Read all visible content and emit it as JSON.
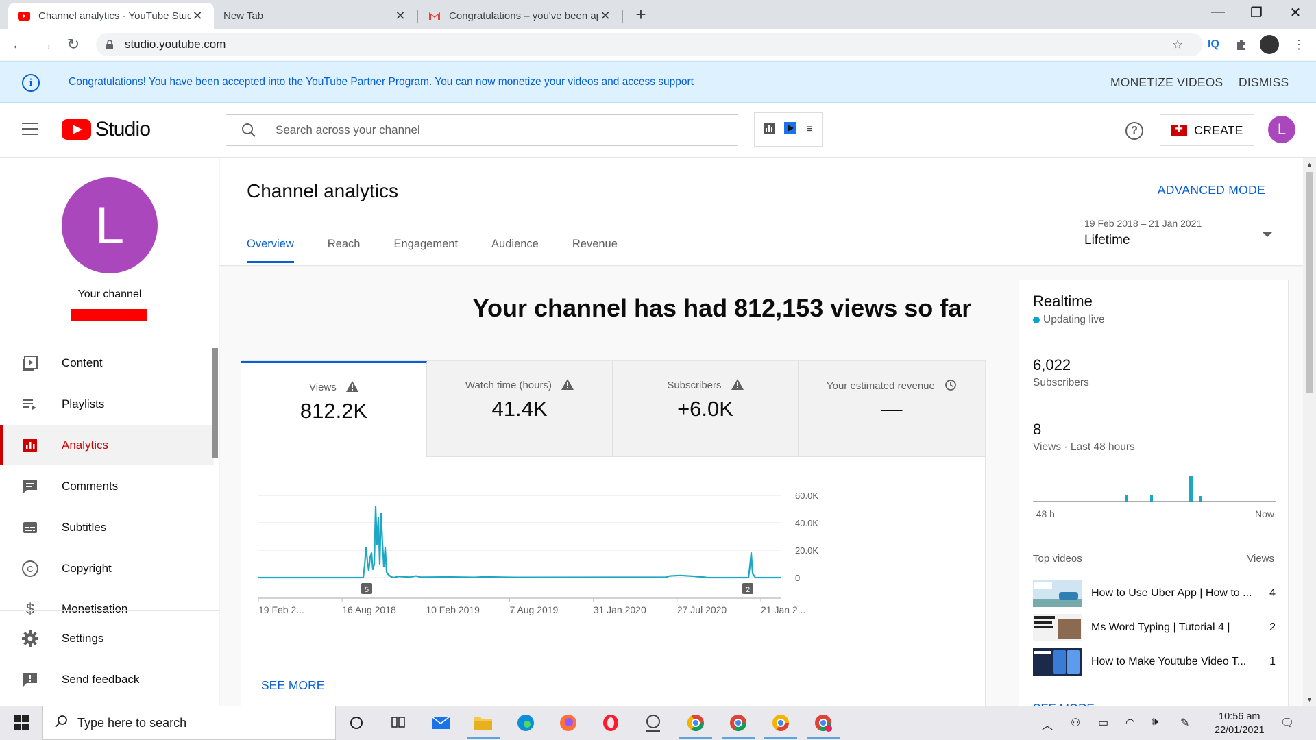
{
  "browser": {
    "tabs": [
      {
        "title": "Channel analytics - YouTube Studio"
      },
      {
        "title": "New Tab"
      },
      {
        "title": "Congratulations – you've been approved"
      }
    ],
    "url": "studio.youtube.com"
  },
  "banner": {
    "message": "Congratulations! You have been accepted into the YouTube Partner Program. You can now monetize your videos and access support",
    "monetize_label": "MONETIZE VIDEOS",
    "dismiss_label": "DISMISS"
  },
  "header": {
    "logo_text": "Studio",
    "search_placeholder": "Search across your channel",
    "create_label": "CREATE",
    "avatar_letter": "L"
  },
  "sidebar": {
    "avatar_letter": "L",
    "channel_label": "Your channel",
    "items": [
      {
        "label": "Content",
        "icon": "content-icon"
      },
      {
        "label": "Playlists",
        "icon": "playlists-icon"
      },
      {
        "label": "Analytics",
        "icon": "analytics-icon"
      },
      {
        "label": "Comments",
        "icon": "comments-icon"
      },
      {
        "label": "Subtitles",
        "icon": "subtitles-icon"
      },
      {
        "label": "Copyright",
        "icon": "copyright-icon"
      },
      {
        "label": "Monetisation",
        "icon": "monetisation-icon"
      },
      {
        "label": "Settings",
        "icon": "settings-icon"
      },
      {
        "label": "Send feedback",
        "icon": "feedback-icon"
      }
    ]
  },
  "page": {
    "title": "Channel analytics",
    "advanced_mode": "ADVANCED MODE",
    "tabs": [
      "Overview",
      "Reach",
      "Engagement",
      "Audience",
      "Revenue"
    ],
    "date_range": "19 Feb 2018 – 21 Jan 2021",
    "period": "Lifetime",
    "headline": "Your channel has had 812,153 views so far"
  },
  "metrics": [
    {
      "label": "Views",
      "value": "812.2K"
    },
    {
      "label": "Watch time (hours)",
      "value": "41.4K"
    },
    {
      "label": "Subscribers",
      "value": "+6.0K"
    },
    {
      "label": "Your estimated revenue",
      "value": "—"
    }
  ],
  "chart_data": {
    "type": "line",
    "series": [
      {
        "values": []
      }
    ],
    "x_tick_labels": [
      "19 Feb 2...",
      "16 Aug 2018",
      "10 Feb 2019",
      "7 Aug 2019",
      "31 Jan 2020",
      "27 Jul 2020",
      "21 Jan 2..."
    ],
    "y_tick_labels": [
      "60.0K",
      "40.0K",
      "20.0K",
      "0"
    ],
    "ylim": [
      0,
      60000
    ],
    "markers": [
      "5",
      "2"
    ],
    "color": "#1ea7c5",
    "see_more": "SEE MORE"
  },
  "realtime": {
    "title": "Realtime",
    "status": "Updating live",
    "subscribers_value": "6,022",
    "subscribers_label": "Subscribers",
    "views_value": "8",
    "views_label": "Views · Last 48 hours",
    "axis_start": "-48 h",
    "axis_end": "Now",
    "top_videos_label": "Top videos",
    "views_col_label": "Views",
    "videos": [
      {
        "title": "How to Use Uber App | How to ...",
        "views": "4"
      },
      {
        "title": "Ms Word Typing | Tutorial 4 |",
        "views": "2"
      },
      {
        "title": "How to Make Youtube Video T...",
        "views": "1"
      }
    ],
    "see_more": "SEE MORE"
  },
  "taskbar": {
    "search_placeholder": "Type here to search",
    "time": "10:56 am",
    "date": "22/01/2021"
  }
}
